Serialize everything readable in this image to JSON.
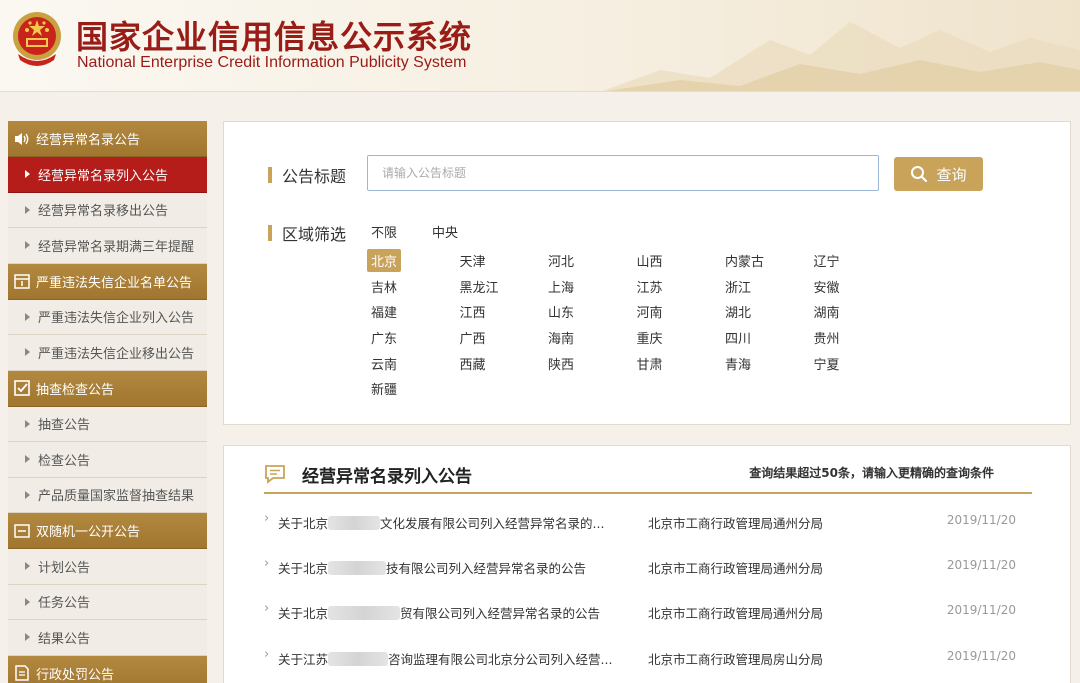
{
  "header": {
    "title_cn": "国家企业信用信息公示系统",
    "title_en": "National Enterprise Credit Information Publicity System"
  },
  "colors": {
    "brand_red": "#9a1c16",
    "gold": "#c9a35a",
    "active_red": "#b51d1b",
    "sidebar_cat": "#a87c35"
  },
  "sidebar": {
    "groups": [
      {
        "icon": "speaker-icon",
        "label": "经营异常名录公告",
        "items": [
          {
            "label": "经营异常名录列入公告",
            "active": true
          },
          {
            "label": "经营异常名录移出公告"
          },
          {
            "label": "经营异常名录期满三年提醒"
          }
        ]
      },
      {
        "icon": "calendar-icon",
        "label": "严重违法失信企业名单公告",
        "items": [
          {
            "label": "严重违法失信企业列入公告"
          },
          {
            "label": "严重违法失信企业移出公告"
          }
        ]
      },
      {
        "icon": "checkbox-icon",
        "label": "抽查检查公告",
        "items": [
          {
            "label": "抽查公告"
          },
          {
            "label": "检查公告"
          },
          {
            "label": "产品质量国家监督抽查结果"
          }
        ]
      },
      {
        "icon": "window-icon",
        "label": "双随机一公开公告",
        "items": [
          {
            "label": "计划公告"
          },
          {
            "label": "任务公告"
          },
          {
            "label": "结果公告"
          }
        ]
      },
      {
        "icon": "document-icon",
        "label": "行政处罚公告",
        "items": []
      }
    ]
  },
  "filter": {
    "title_label": "公告标题",
    "search_placeholder": "请输入公告标题",
    "search_button": "查询",
    "region_label": "区域筛选",
    "region_top": [
      "不限",
      "中央"
    ],
    "regions": [
      "北京",
      "天津",
      "河北",
      "山西",
      "内蒙古",
      "辽宁",
      "吉林",
      "黑龙江",
      "上海",
      "江苏",
      "浙江",
      "安徽",
      "福建",
      "江西",
      "山东",
      "河南",
      "湖北",
      "湖南",
      "广东",
      "广西",
      "海南",
      "重庆",
      "四川",
      "贵州",
      "云南",
      "西藏",
      "陕西",
      "甘肃",
      "青海",
      "宁夏",
      "新疆"
    ],
    "active_region": "北京"
  },
  "results": {
    "title": "经营异常名录列入公告",
    "note": "查询结果超过50条，请输入更精确的查询条件",
    "rows": [
      {
        "pre": "关于北京",
        "post": "文化发展有限公司列入经营异常名录的...",
        "org": "北京市工商行政管理局通州分局",
        "date": "2019/11/20"
      },
      {
        "pre": "关于北京",
        "post": "技有限公司列入经营异常名录的公告",
        "org": "北京市工商行政管理局通州分局",
        "date": "2019/11/20"
      },
      {
        "pre": "关于北京",
        "post": "贸有限公司列入经营异常名录的公告",
        "org": "北京市工商行政管理局通州分局",
        "date": "2019/11/20"
      },
      {
        "pre": "关于江苏",
        "post": "咨询监理有限公司北京分公司列入经营...",
        "org": "北京市工商行政管理局房山分局",
        "date": "2019/11/20"
      }
    ]
  }
}
